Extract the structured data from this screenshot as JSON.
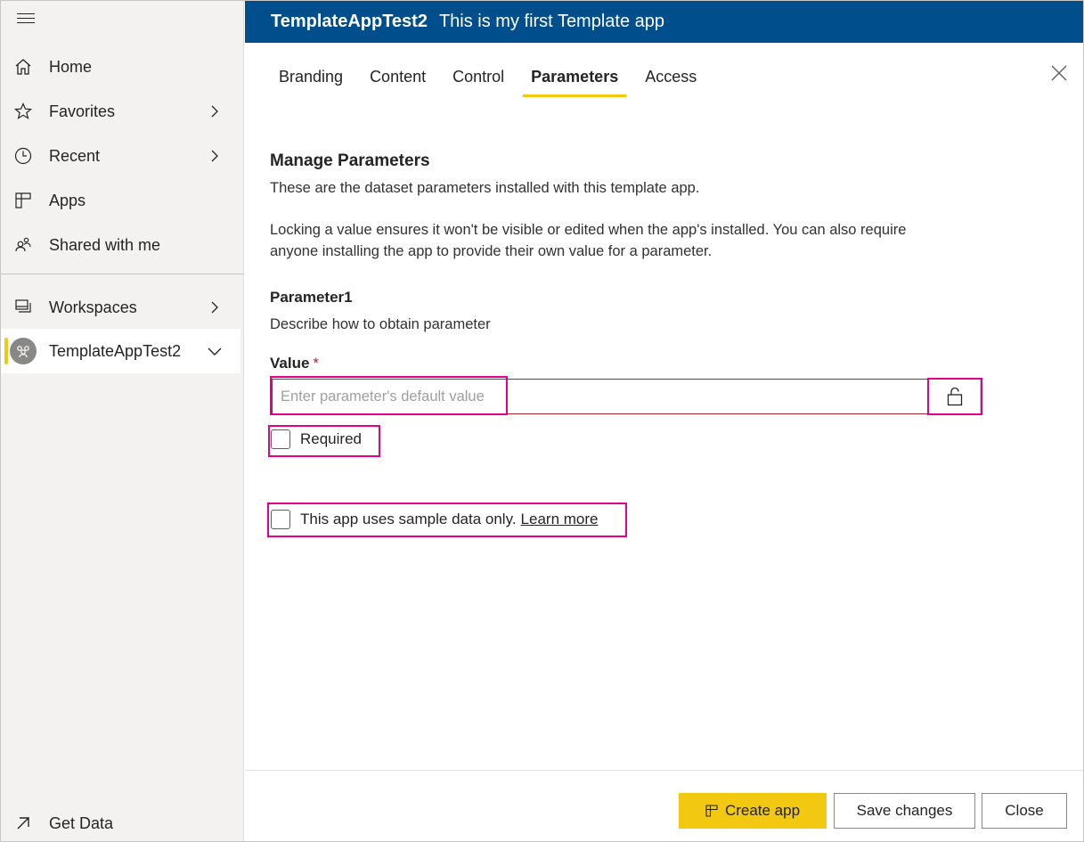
{
  "sidebar": {
    "menu_icon": "hamburger-icon",
    "items": [
      {
        "label": "Home",
        "icon": "home-icon"
      },
      {
        "label": "Favorites",
        "icon": "star-icon"
      },
      {
        "label": "Recent",
        "icon": "clock-icon"
      },
      {
        "label": "Apps",
        "icon": "apps-icon"
      },
      {
        "label": "Shared with me",
        "icon": "shared-icon"
      },
      {
        "label": "Workspaces",
        "icon": "workspaces-icon"
      },
      {
        "label": "TemplateAppTest2",
        "icon": "workspace-avatar-icon"
      }
    ],
    "footer_item": {
      "label": "Get Data",
      "icon": "arrow-up-right-icon"
    }
  },
  "header": {
    "app_name": "TemplateAppTest2",
    "app_description": "This is my first Template app"
  },
  "tabs": [
    "Branding",
    "Content",
    "Control",
    "Parameters",
    "Access"
  ],
  "active_tab": "Parameters",
  "main": {
    "title": "Manage Parameters",
    "intro": "These are the dataset parameters installed with this template app.",
    "lock_info_line1": "Locking a value ensures it won't be visible or edited when the app's installed. You can also require",
    "lock_info_line2": "anyone installing the app to provide their own value for a parameter.",
    "parameter": {
      "name": "Parameter1",
      "description": "Describe how to obtain parameter",
      "value_label": "Value",
      "required_marker": "*",
      "value": "",
      "placeholder": "Enter parameter's default value",
      "required_label": "Required",
      "required_checked": false
    },
    "sample_data_label": "This app uses sample data only.",
    "sample_data_checked": false,
    "learn_more": "Learn more"
  },
  "footer": {
    "create_app": "Create app",
    "save_changes": "Save changes",
    "close": "Close"
  },
  "colors": {
    "header_bg": "#004e8c",
    "accent_yellow": "#f2c811",
    "error_red": "#a4262c",
    "highlight_magenta": "#e3008c"
  }
}
